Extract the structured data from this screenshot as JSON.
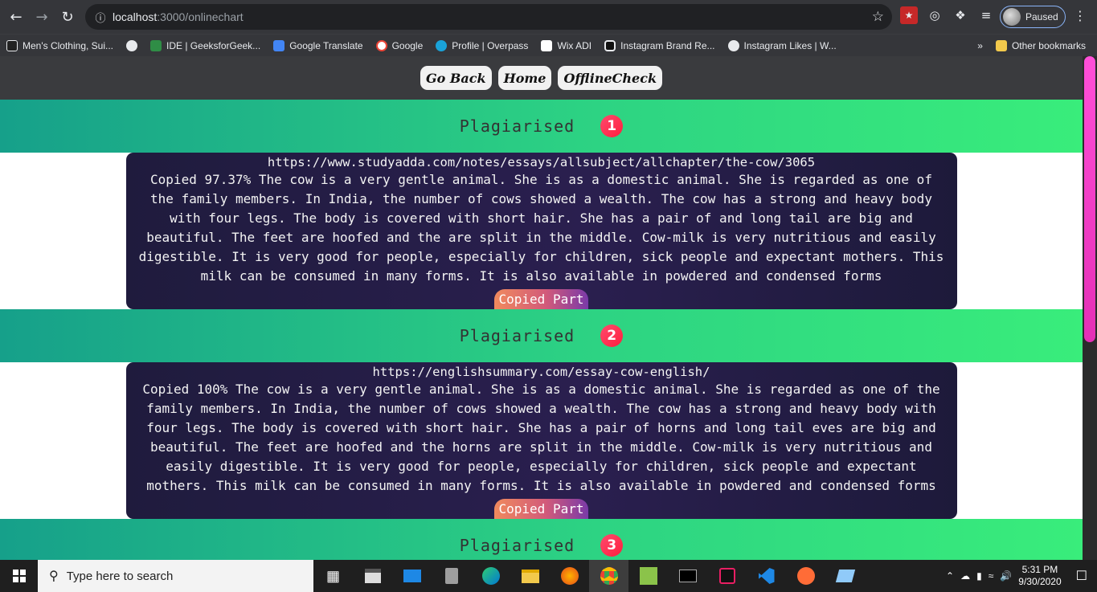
{
  "browser": {
    "url_host": "localhost",
    "url_path": ":3000/onlinechart",
    "profile_label": "Paused",
    "bookmarks": [
      {
        "label": "Men's Clothing, Sui...",
        "color": "#222222"
      },
      {
        "label": "",
        "color": "#e8eaed"
      },
      {
        "label": "IDE | GeeksforGeek...",
        "color": "#2f8d46"
      },
      {
        "label": "Google Translate",
        "color": "#4285f4"
      },
      {
        "label": "Google",
        "color": "#ffffff"
      },
      {
        "label": "Profile | Overpass",
        "color": "#1aa3d9"
      },
      {
        "label": "Wix ADI",
        "color": "#111111"
      },
      {
        "label": "Instagram Brand Re...",
        "color": "#111111"
      },
      {
        "label": "Instagram Likes | W...",
        "color": "#e8eaed"
      }
    ],
    "overflow_label": "»",
    "other_bookmarks": "Other bookmarks"
  },
  "nav": {
    "go_back": "Go Back",
    "home": "Home",
    "offline_check": "OfflineCheck"
  },
  "results": [
    {
      "title": "Plagiarised",
      "index": "1",
      "url": "https://www.studyadda.com/notes/essays/allsubject/allchapter/the-cow/3065",
      "text": "Copied 97.37% The cow is a very gentle animal. She is as a domestic animal. She is regarded as one of the family members. In India, the number of cows showed a wealth. The cow has a strong and heavy body with four legs. The body is covered with short hair. She has a pair of and long tail are big and beautiful. The feet are hoofed and the are split in the middle. Cow-milk is very nutritious and easily digestible. It is very good for people, especially for children, sick people and expectant mothers. This milk can be consumed in many forms. It is also available in powdered and condensed forms",
      "button": "Copied Part"
    },
    {
      "title": "Plagiarised",
      "index": "2",
      "url": "https://englishsummary.com/essay-cow-english/",
      "text": "Copied 100% The cow is a very gentle animal. She is as a domestic animal. She is regarded as one of the family members. In India, the number of cows showed a wealth. The cow has a strong and heavy body with four legs. The body is covered with short hair. She has a pair of horns and long tail eves are big and beautiful. The feet are hoofed and the horns are split in the middle. Cow-milk is very nutritious and easily digestible. It is very good for people, especially for children, sick people and expectant mothers. This milk can be consumed in many forms. It is also available in powdered and condensed forms",
      "button": "Copied Part"
    },
    {
      "title": "Plagiarised",
      "index": "3"
    }
  ],
  "taskbar": {
    "search_placeholder": "Type here to search",
    "time": "5:31 PM",
    "date": "9/30/2020"
  }
}
